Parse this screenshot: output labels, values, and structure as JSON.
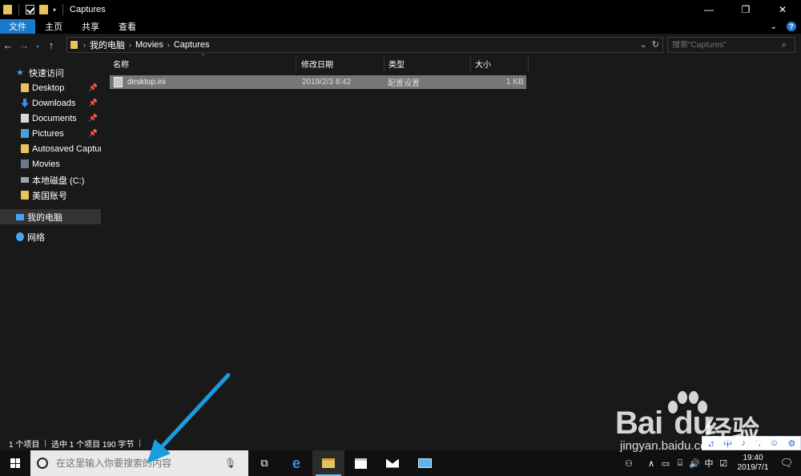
{
  "window": {
    "title": "Captures",
    "controls": [
      "—",
      "❐",
      "✕"
    ]
  },
  "ribbon": {
    "tabs": [
      "文件",
      "主页",
      "共享",
      "查看"
    ],
    "collapse": "⌄",
    "help": "?"
  },
  "address": {
    "crumbs": [
      "我的电脑",
      "Movies",
      "Captures"
    ],
    "dropdown": "⌄",
    "refresh": "↻",
    "search_placeholder": "搜索\"Captures\""
  },
  "nav": {
    "quick_access": "快速访问",
    "items": [
      {
        "label": "Desktop",
        "icon": "folder-icon",
        "pinned": true
      },
      {
        "label": "Downloads",
        "icon": "download-icon",
        "pinned": true
      },
      {
        "label": "Documents",
        "icon": "documents-icon",
        "pinned": true
      },
      {
        "label": "Pictures",
        "icon": "pictures-icon",
        "pinned": true
      },
      {
        "label": "Autosaved Capture",
        "icon": "folder-icon",
        "pinned": false
      },
      {
        "label": "Movies",
        "icon": "movies-icon",
        "pinned": false
      },
      {
        "label": "本地磁盘 (C:)",
        "icon": "disk-icon",
        "pinned": false
      },
      {
        "label": "美国账号",
        "icon": "folder-icon",
        "pinned": false
      }
    ],
    "this_pc": "我的电脑",
    "network": "网络"
  },
  "columns": [
    "名称",
    "修改日期",
    "类型",
    "大小"
  ],
  "files": [
    {
      "name": "desktop.ini",
      "modified": "2019/2/3 8:42",
      "type": "配置设置",
      "size": "1 KB"
    }
  ],
  "status": {
    "count": "1 个项目",
    "selected": "选中 1 个项目  190 字节"
  },
  "taskbar": {
    "search_placeholder": "在这里输入你要搜索的内容",
    "ime_lang": "中",
    "time": "19:40",
    "date": "2019/7/1"
  },
  "ime_bar": [
    "中",
    "♪",
    "°,",
    "☺",
    "⚙"
  ],
  "watermark": {
    "text_bai": "Bai",
    "text_du": "du",
    "text_cn": "经验",
    "url": "jingyan.baidu.com"
  },
  "colors": {
    "accent": "#1979ca",
    "selection": "#777777",
    "arrow": "#1a9ce0"
  }
}
